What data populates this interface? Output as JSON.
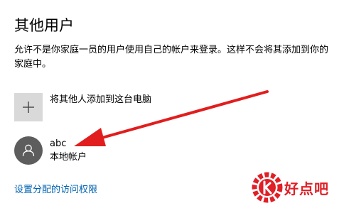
{
  "page": {
    "title": "其他用户",
    "description": "允许不是你家庭一员的用户使用自己的帐户来登录。这样不会将其添加到你的家庭中。"
  },
  "add_user": {
    "label": "将其他人添加到这台电脑",
    "icon": "plus-icon"
  },
  "users": [
    {
      "name": "abc",
      "type": "本地帐户",
      "icon": "person-icon"
    }
  ],
  "permissions_link": "设置分配的访问权限",
  "annotation": {
    "arrow_color": "#e11d1d"
  },
  "watermark": {
    "text": "好点吧",
    "color": "#e01f26"
  },
  "colors": {
    "link": "#0063b1",
    "tile": "#d9d9d9",
    "avatar": "#5d5d5d"
  }
}
